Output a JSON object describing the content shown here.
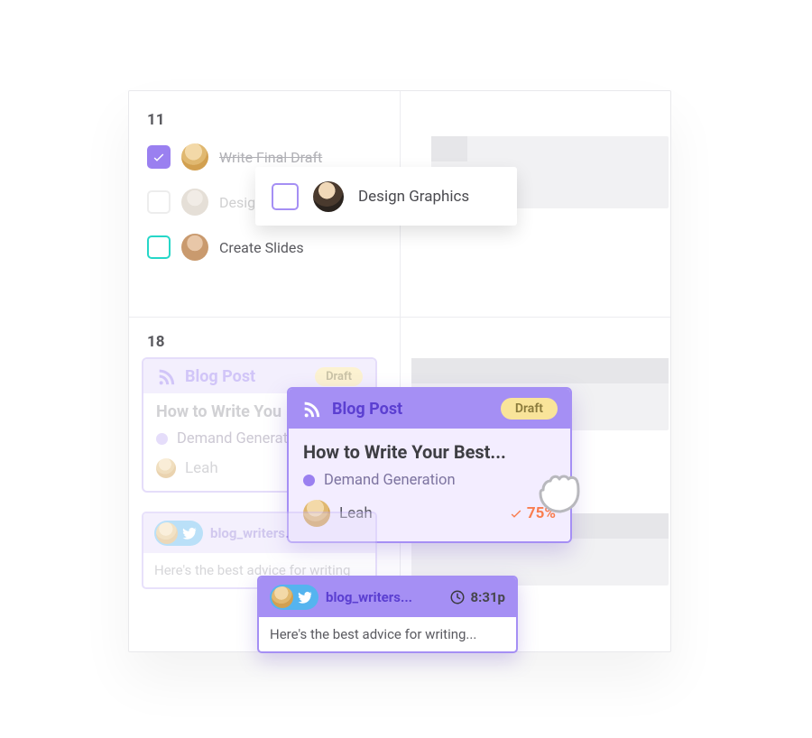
{
  "calendar": {
    "day_top": "11",
    "day_bottom": "18",
    "tasks": [
      {
        "label": "Write Final Draft",
        "checked": true
      },
      {
        "label": "Design Graphics",
        "checked": false
      },
      {
        "label": "Create Slides",
        "checked": false
      }
    ],
    "floating_task": {
      "label": "Design Graphics"
    }
  },
  "blog_card_bg": {
    "type_label": "Blog Post",
    "status": "Draft",
    "title": "How to Write You",
    "tag": "Demand Generatio",
    "assignee": "Leah"
  },
  "blog_card": {
    "type_label": "Blog Post",
    "status": "Draft",
    "title": "How to Write Your Best...",
    "tag": "Demand Generation",
    "assignee": "Leah",
    "progress": "75%"
  },
  "social_bg": {
    "handle": "blog_writers.",
    "snippet": "Here's the best advice for writing"
  },
  "social": {
    "handle": "blog_writers...",
    "time": "8:31p",
    "snippet": "Here's the best advice for writing..."
  },
  "icons": {
    "rss": "rss-icon",
    "twitter": "twitter-icon",
    "clock": "clock-icon",
    "check": "check-icon",
    "grab": "grab-cursor-icon"
  }
}
